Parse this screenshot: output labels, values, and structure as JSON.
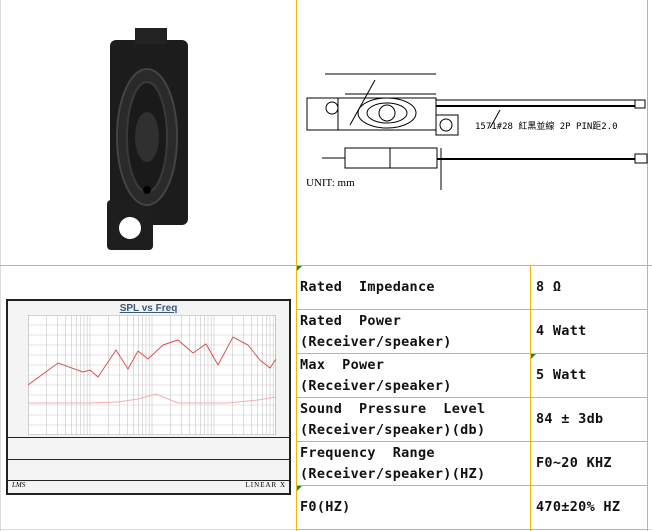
{
  "drawing": {
    "unit_label": "UNIT: mm",
    "wire_note": "1571#28  紅黑並線 2P PIN距2.0"
  },
  "chart": {
    "title": "SPL vs Freq",
    "logo_left": "LMS",
    "logo_right": "LINEAR X",
    "series_color": "#d9534f"
  },
  "specs": [
    {
      "label": "Rated  Impedance",
      "value": "8 Ω"
    },
    {
      "label": "Rated  Power\n(Receiver/speaker)",
      "value": "4 Watt"
    },
    {
      "label": "Max  Power\n(Receiver/speaker)",
      "value": "5 Watt"
    },
    {
      "label": "Sound  Pressure  Level\n(Receiver/speaker)(db)",
      "value": "84 ± 3db"
    },
    {
      "label": "Frequency  Range\n(Receiver/speaker)(HZ)",
      "value": "F0~20 KHZ"
    },
    {
      "label": "F0(HZ)",
      "value": "470±20% HZ"
    }
  ],
  "colors": {
    "grid": "#f2b705"
  }
}
